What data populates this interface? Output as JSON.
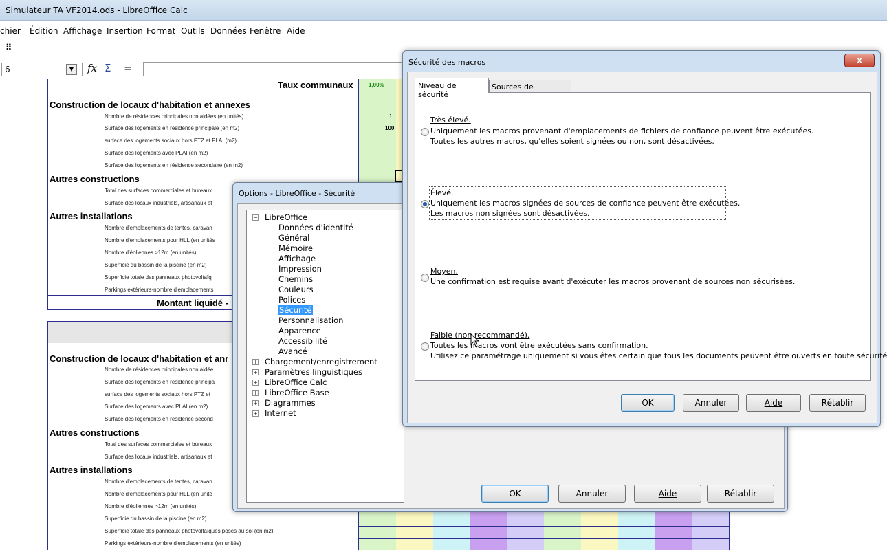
{
  "window": {
    "title": "Simulateur TA VF2014.ods - LibreOffice Calc"
  },
  "menu": [
    "chier",
    "Édition",
    "Affichage",
    "Insertion",
    "Format",
    "Outils",
    "Données",
    "Fenêtre",
    "Aide"
  ],
  "formula_bar": {
    "cell_ref": "6",
    "fx": "fx",
    "sum": "Σ",
    "equals": "="
  },
  "sheet": {
    "taux_label": "Taux communaux",
    "taux_value": "1,00%",
    "value_1": "1",
    "value_100": "100",
    "montant_label": "Montant liquidé -",
    "block1": {
      "sec1": "Construction de locaux d'habitation et annexes",
      "rows1": [
        "Nombre de résidences principales non aidées (en unités)",
        "Surface des logements en résidence principale (en m2)",
        "surface des logements sociaux hors PTZ et PLAI (m2)",
        "Surface des logements avec PLAI (en m2)",
        "Surface des logements en résidence secondaire (en m2)"
      ],
      "sec2": "Autres constructions",
      "rows2": [
        "Total des surfaces commerciales et bureaux",
        "Surface des locaux industriels, artisanaux et"
      ],
      "sec3": "Autres installations",
      "rows3": [
        "Nombre d'emplacements de tentes, caravan",
        "Nombre d'emplacements pour HLL (en unités",
        "Nombre d'éoliennes >12m (en unités)",
        "Superficie du bassin de la piscine (en m2)",
        "Superficie totale des panneaux photovoltaïq",
        "Parkings extérieurs-nombre d'emplacements"
      ]
    },
    "block2": {
      "sec1": "Construction de locaux d'habitation et anr",
      "rows1": [
        "Nombre de résidences principales non aidée",
        "Surface des logements en résidence principa",
        "surface des logements sociaux hors PTZ et",
        "Surface des logements avec PLAI (en m2)",
        "Surface des logements en résidence second"
      ],
      "sec2": "Autres constructions",
      "rows2": [
        "Total des surfaces commerciales et bureaux",
        "Surface des locaux industriels, artisanaux et"
      ],
      "sec3": "Autres installations",
      "rows3": [
        "Nombre d'emplacements de tentes, caravan",
        "Nombre d'emplacements pour HLL (en unité",
        "Nombre d'éoliennes >12m (en unités)",
        "Superficie du bassin de la piscine (en m2)",
        "Superficie totale des panneaux photovoltaïques posés au sol (en m2)",
        "Parkings extérieurs-nombre d'emplacements (en unités)"
      ]
    }
  },
  "options_dialog": {
    "title": "Options - LibreOffice - Sécurité",
    "tree_root": "LibreOffice",
    "tree_children": [
      "Données d'identité",
      "Général",
      "Mémoire",
      "Affichage",
      "Impression",
      "Chemins",
      "Couleurs",
      "Polices",
      "Sécurité",
      "Personnalisation",
      "Apparence",
      "Accessibilité",
      "Avancé"
    ],
    "tree_others": [
      "Chargement/enregistrement",
      "Paramètres linguistiques",
      "LibreOffice Calc",
      "LibreOffice Base",
      "Diagrammes",
      "Internet"
    ],
    "buttons": {
      "ok": "OK",
      "cancel": "Annuler",
      "help": "Aide",
      "reset": "Rétablir"
    }
  },
  "macro_dialog": {
    "title": "Sécurité des macros",
    "close": "x",
    "tabs": [
      "Niveau de sécurité",
      "Sources de confiance"
    ],
    "options": [
      {
        "label": "Très élevé.",
        "line1": "Uniquement les macros provenant d'emplacements de fichiers de confiance peuvent être exécutées.",
        "line2": "Toutes les autres macros, qu'elles soient signées ou non, sont désactivées."
      },
      {
        "label": "Élevé.",
        "line1": "Uniquement les macros signées de sources de confiance peuvent être exécutées.",
        "line2": "Les macros non signées sont désactivées."
      },
      {
        "label": "Moyen.",
        "line1": "Une confirmation est requise avant d'exécuter les macros provenant de sources non sécurisées.",
        "line2": ""
      },
      {
        "label": "Faible (non recommandé).",
        "line1": "Toutes les macros vont être exécutées sans confirmation.",
        "line2": "Utilisez ce paramétrage uniquement si vous êtes certain que tous les documents peuvent être ouverts en toute sécurité."
      }
    ],
    "selected": 1,
    "buttons": {
      "ok": "OK",
      "cancel": "Annuler",
      "help": "Aide",
      "reset": "Rétablir"
    }
  },
  "colors": {
    "green": "#d9f5c8",
    "yellow": "#fbf7c0",
    "cyan": "#cdf3f6",
    "purple": "#c9a0f0",
    "lavender": "#d4cdf8",
    "border": "#2e2e8f"
  }
}
